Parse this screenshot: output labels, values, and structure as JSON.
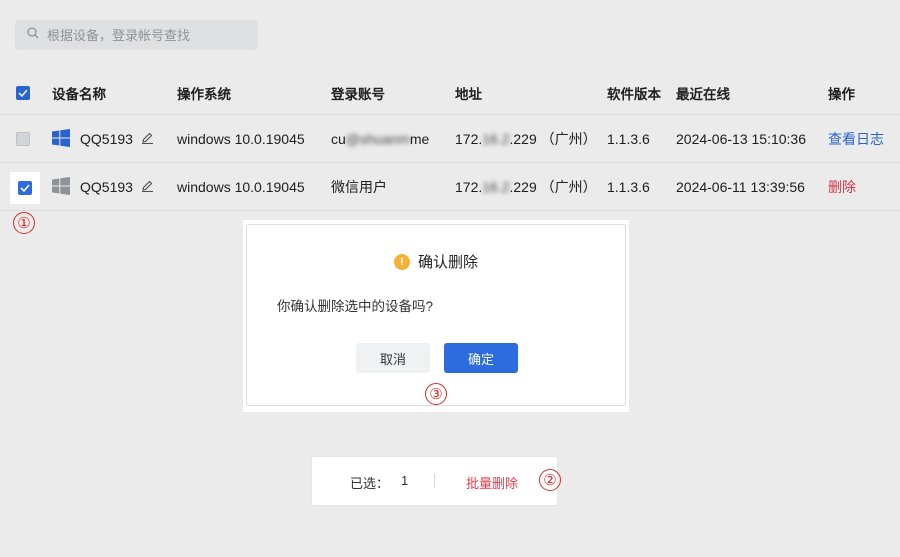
{
  "search": {
    "placeholder": "根据设备，登录帐号查找",
    "icon": "search-icon"
  },
  "table": {
    "headers": [
      "设备名称",
      "操作系统",
      "登录账号",
      "地址",
      "软件版本",
      "最近在线",
      "操作"
    ],
    "rows": [
      {
        "checked": false,
        "os_icon": "windows-icon",
        "name": "QQ5193",
        "os": "windows 10.0.19045",
        "account_pre": "cu",
        "account_blur": "@shuanm",
        "account_post": "me",
        "addr_pre": "172.",
        "addr_blur": "16.2",
        "addr_post": ".229 （广州）",
        "version": "1.1.3.6",
        "last_online": "2024-06-13 15:10:36",
        "action": "查看日志"
      },
      {
        "checked": true,
        "os_icon": "windows-icon",
        "name": "QQ5193",
        "os": "windows 10.0.19045",
        "account": "微信用户",
        "addr_pre": "172.",
        "addr_blur": "16.2",
        "addr_post": ".229 （广州）",
        "version": "1.1.3.6",
        "last_online": "2024-06-11 13:39:56",
        "action": "删除"
      }
    ]
  },
  "modal": {
    "title": "确认删除",
    "message": "你确认删除选中的设备吗?",
    "cancel_label": "取消",
    "ok_label": "确定"
  },
  "footer_bar": {
    "selected_label": "已选：",
    "selected_count": "1",
    "batch_delete_label": "批量删除"
  },
  "steps": [
    "①",
    "②",
    "③"
  ],
  "colors": {
    "primary": "#2d6cdf",
    "danger": "#e23c4e",
    "warning": "#f5b335",
    "annotation": "#d72b2b"
  }
}
